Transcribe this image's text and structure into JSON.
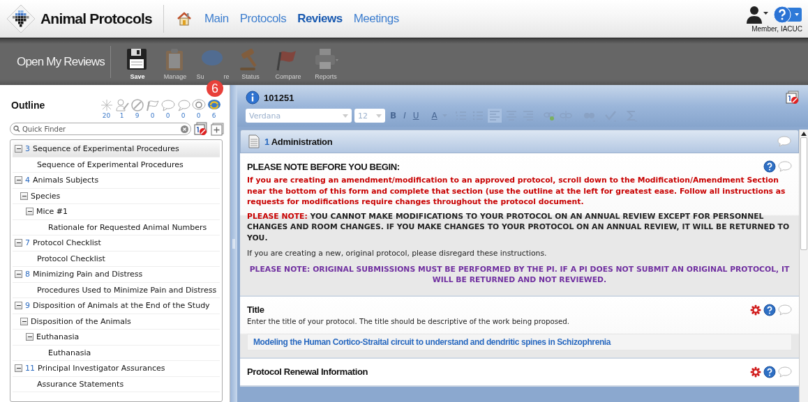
{
  "app": {
    "title": "Animal Protocols"
  },
  "nav": [
    {
      "label": "Main",
      "selected": false
    },
    {
      "label": "Protocols",
      "selected": false
    },
    {
      "label": "Reviews",
      "selected": true
    },
    {
      "label": "Meetings",
      "selected": false
    }
  ],
  "user": {
    "role": "Member, IACUC"
  },
  "toolbar": {
    "title": "Open My Reviews",
    "buttons": [
      {
        "kind": "save",
        "label": "Save",
        "disabled": false
      },
      {
        "kind": "manage",
        "label": "Manage",
        "disabled": true
      },
      {
        "kind": "summarize",
        "label_parts": [
          "Su",
          "re"
        ],
        "disabled": true
      },
      {
        "kind": "status",
        "label": "Status",
        "disabled": true
      },
      {
        "kind": "compare",
        "label": "Compare",
        "disabled": true
      },
      {
        "kind": "reports",
        "label": "Reports",
        "disabled": true
      }
    ]
  },
  "badge": "6",
  "outline": {
    "title": "Outline",
    "filters": [
      {
        "kind": "all",
        "count": "20"
      },
      {
        "kind": "assigned",
        "count": "1"
      },
      {
        "kind": "blocked",
        "count": "9"
      },
      {
        "kind": "flag",
        "count": "0"
      },
      {
        "kind": "comment",
        "count": "0"
      },
      {
        "kind": "reply",
        "count": "0"
      },
      {
        "kind": "refresh",
        "count": "0"
      },
      {
        "kind": "changed",
        "count": "6"
      }
    ],
    "search": {
      "placeholder": "Quick Finder"
    },
    "tree": [
      {
        "number": "3",
        "label": "Sequence of Experimental Procedures",
        "expanded": true,
        "selected": true,
        "children": [
          {
            "label": "Sequence of Experimental Procedures",
            "selected": false
          }
        ]
      },
      {
        "number": "4",
        "label": "Animals Subjects",
        "expanded": true,
        "selected": false,
        "children": [
          {
            "label": "Species",
            "expanded": true,
            "selected": false,
            "children": [
              {
                "label": "Mice #1",
                "expanded": true,
                "selected": false,
                "children": [
                  {
                    "label": "Rationale for Requested Animal Numbers",
                    "selected": false
                  }
                ]
              }
            ]
          }
        ]
      },
      {
        "number": "7",
        "label": "Protocol Checklist",
        "expanded": true,
        "selected": false,
        "children": [
          {
            "label": "Protocol Checklist",
            "selected": false
          }
        ]
      },
      {
        "number": "8",
        "label": "Minimizing Pain and Distress",
        "expanded": true,
        "selected": false,
        "children": [
          {
            "label": "Procedures Used to Minimize Pain and Distress",
            "selected": false
          }
        ]
      },
      {
        "number": "9",
        "label": "Disposition of Animals at the End of the Study",
        "expanded": true,
        "selected": false,
        "children": [
          {
            "label": "Disposition of the Animals",
            "expanded": true,
            "selected": false,
            "children": [
              {
                "label": "Euthanasia",
                "expanded": true,
                "selected": false,
                "children": [
                  {
                    "label": "Euthanasia",
                    "selected": false
                  }
                ]
              }
            ]
          }
        ]
      },
      {
        "number": "11",
        "label": "Principal Investigator Assurances",
        "expanded": true,
        "selected": false,
        "children": [
          {
            "label": "Assurance Statements",
            "selected": false
          }
        ]
      }
    ]
  },
  "document": {
    "id": "101251",
    "editor": {
      "font": "Verdana",
      "size": "12",
      "format_buttons": [
        "B",
        "I",
        "U",
        "A"
      ],
      "alignments": [
        {
          "kind": "left",
          "selected": true
        },
        {
          "kind": "center",
          "selected": false
        },
        {
          "kind": "right",
          "selected": false
        }
      ]
    },
    "section": {
      "number": "1",
      "title": "Administration",
      "heading": "PLEASE NOTE BEFORE YOU BEGIN:",
      "paragraphs": [
        {
          "kind": "warning",
          "text": "If you are creating an amendment/modification to an approved protocol, scroll down to the Modification/Amendment Section near the bottom of this form and complete that section (use the outline at the left for greatest ease. Follow all instructions as requests for modifications require changes throughout the protocol document."
        },
        {
          "kind": "notice",
          "lead": "PLEASE NOTE:",
          "text": "YOU CANNOT MAKE MODIFICATIONS TO YOUR PROTOCOL ON AN ANNUAL REVIEW EXCEPT FOR PERSONNEL CHANGES AND ROOM CHANGES. IF YOU MAKE CHANGES TO YOUR PROTOCOL ON AN ANNUAL REVIEW, IT WILL BE RETURNED TO YOU."
        },
        {
          "kind": "plain",
          "text": "If you are creating a new, original protocol, please disregard these instructions."
        },
        {
          "kind": "important",
          "text": "PLEASE NOTE: ORIGINAL SUBMISSIONS MUST BE PERFORMED BY THE PI. IF A PI DOES NOT SUBMIT AN ORIGINAL PROTOCOL, IT WILL BE RETURNED AND NOT REVIEWED."
        }
      ]
    },
    "questions": [
      {
        "title": "Title",
        "required": true,
        "description": "Enter the title of your protocol. The title should be descriptive of the work being proposed.",
        "value": "Modeling the Human Cortico-Straital circuit to understand and dendritic spines in Schizophrenia"
      },
      {
        "title": "Protocol Renewal Information",
        "required": true
      }
    ]
  }
}
